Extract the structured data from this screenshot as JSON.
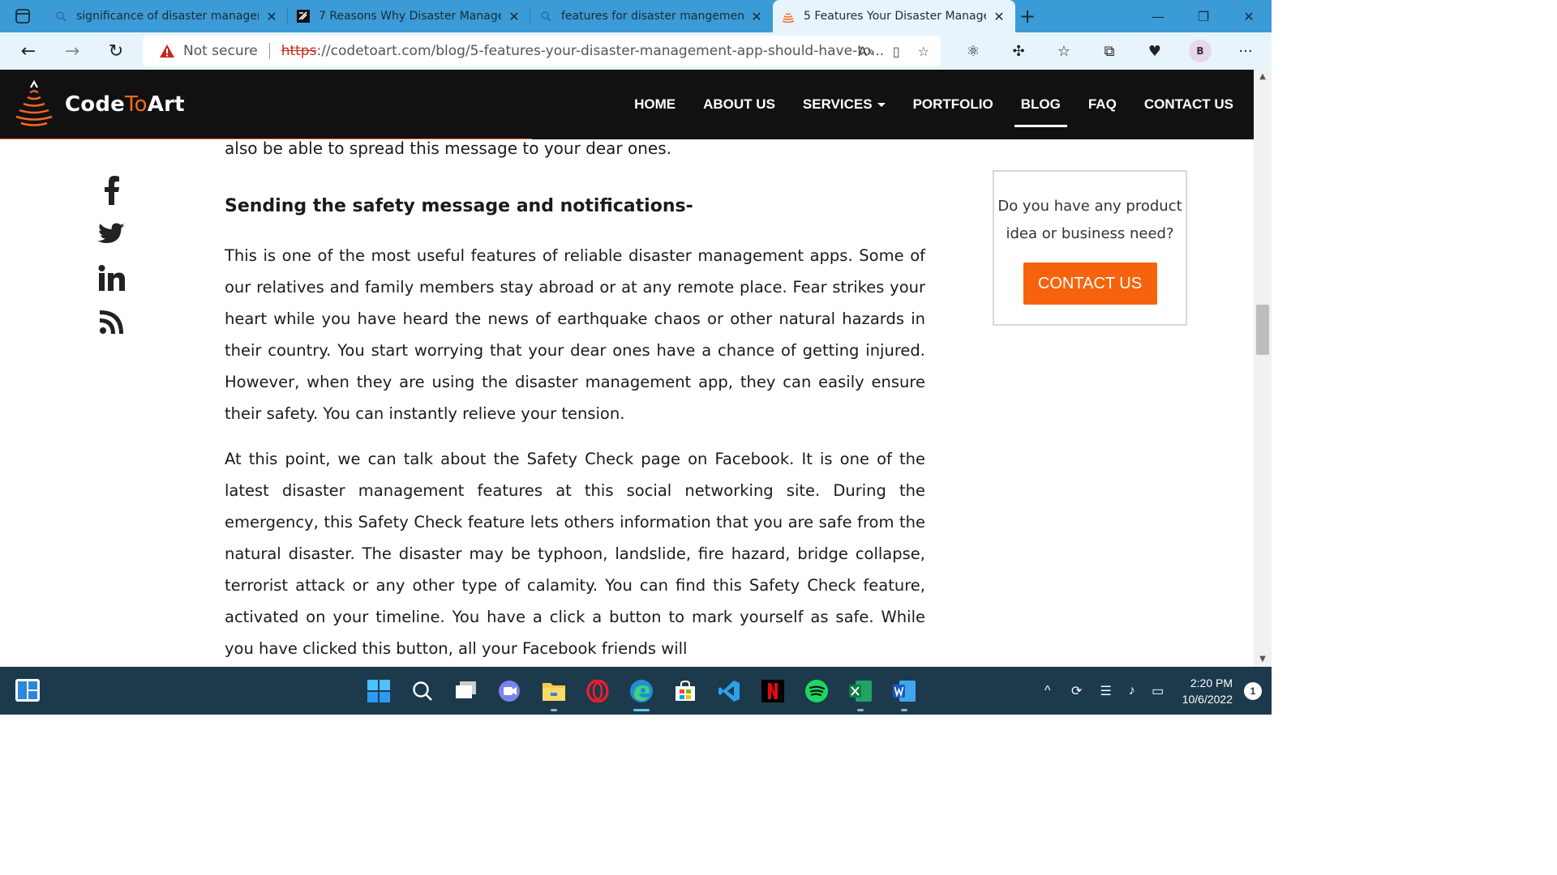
{
  "browser": {
    "tabs": [
      {
        "title": "significance of disaster managem",
        "icon": "search-icon"
      },
      {
        "title": "7 Reasons Why Disaster Manage",
        "icon": "site-icon"
      },
      {
        "title": "features for disaster mangement",
        "icon": "search-icon"
      },
      {
        "title": "5 Features Your Disaster Manage",
        "icon": "codetoart-icon"
      }
    ],
    "address": {
      "security_label": "Not secure",
      "protocol": "https",
      "url_rest": "://codetoart.com/blog/5-features-your-disaster-management-app-should-have-to..."
    },
    "profile_initial": "B"
  },
  "site": {
    "logo": {
      "part1": "Code",
      "part2": "To",
      "part3": "Art"
    },
    "nav": [
      "HOME",
      "ABOUT US",
      "SERVICES",
      "PORTFOLIO",
      "BLOG",
      "FAQ",
      "CONTACT US"
    ],
    "active_nav": "BLOG",
    "reading_progress": 0.42
  },
  "article": {
    "lead": "also be able to spread this message to your dear ones.",
    "heading": "Sending the safety message and notifications-",
    "paragraphs": [
      "This is one of the most useful features of reliable disaster management apps. Some of our relatives and family members stay abroad or at any remote place. Fear strikes your heart while you have heard the news of earthquake chaos or other natural hazards in their country. You start worrying that your dear ones have a chance of getting injured. However, when they are using the disaster management app, they can easily ensure their safety. You can instantly relieve your tension.",
      "At this point, we can talk about the Safety Check page on Facebook. It is one of the latest disaster management features at this social networking site. During the emergency, this Safety Check feature lets others information that you are safe from the natural disaster. The disaster may be typhoon, landslide, fire hazard, bridge collapse, terrorist attack or any other type of calamity. You can find this Safety Check feature, activated on your timeline. You have a click a button to mark yourself as safe. While you have clicked this button, all your Facebook friends will"
    ]
  },
  "sidebar": {
    "question": "Do you have any product idea or business need?",
    "cta": "CONTACT US"
  },
  "taskbar": {
    "time": "2:20 PM",
    "date": "10/6/2022",
    "notifications": "1"
  },
  "colors": {
    "accent": "#f36b21",
    "tabbar": "#3b9bd6",
    "taskbar": "#1d3a4d"
  }
}
